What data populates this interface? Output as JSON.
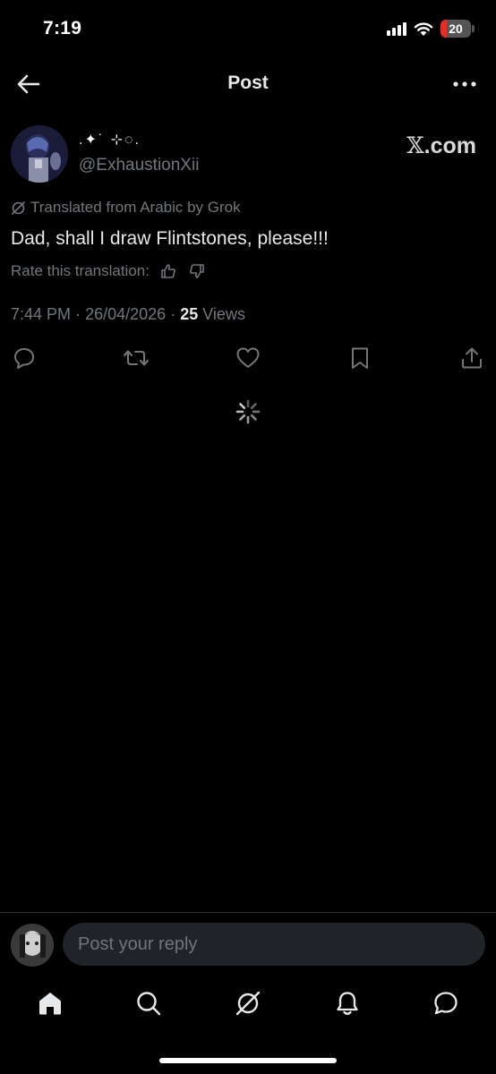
{
  "status": {
    "time": "7:19",
    "battery": "20",
    "battery_level": 0.2
  },
  "header": {
    "title": "Post"
  },
  "post": {
    "display_name": ".✦˙ ⊹◌.",
    "handle": "@ExhaustionXii",
    "source_logo": "𝕏",
    "source_suffix": ".com",
    "translated_label": "Translated from Arabic by Grok",
    "text": "Dad, shall I draw Flintstones, please!!!",
    "rate_label": "Rate this translation:",
    "time": "7:44 PM",
    "separator": "·",
    "date": "26/04/2026",
    "views_count": "25",
    "views_label": "Views"
  },
  "actions": [
    "reply-icon",
    "repost-icon",
    "like-icon",
    "bookmark-icon",
    "share-icon"
  ],
  "reply": {
    "placeholder": "Post your reply"
  },
  "nav": [
    "home-icon",
    "search-icon",
    "grok-icon",
    "notifications-icon",
    "messages-icon"
  ],
  "colors": {
    "background": "#000000",
    "text": "#e7e9ea",
    "muted": "#71767b",
    "reply_field": "#202327",
    "battery_low": "#e0302a"
  }
}
